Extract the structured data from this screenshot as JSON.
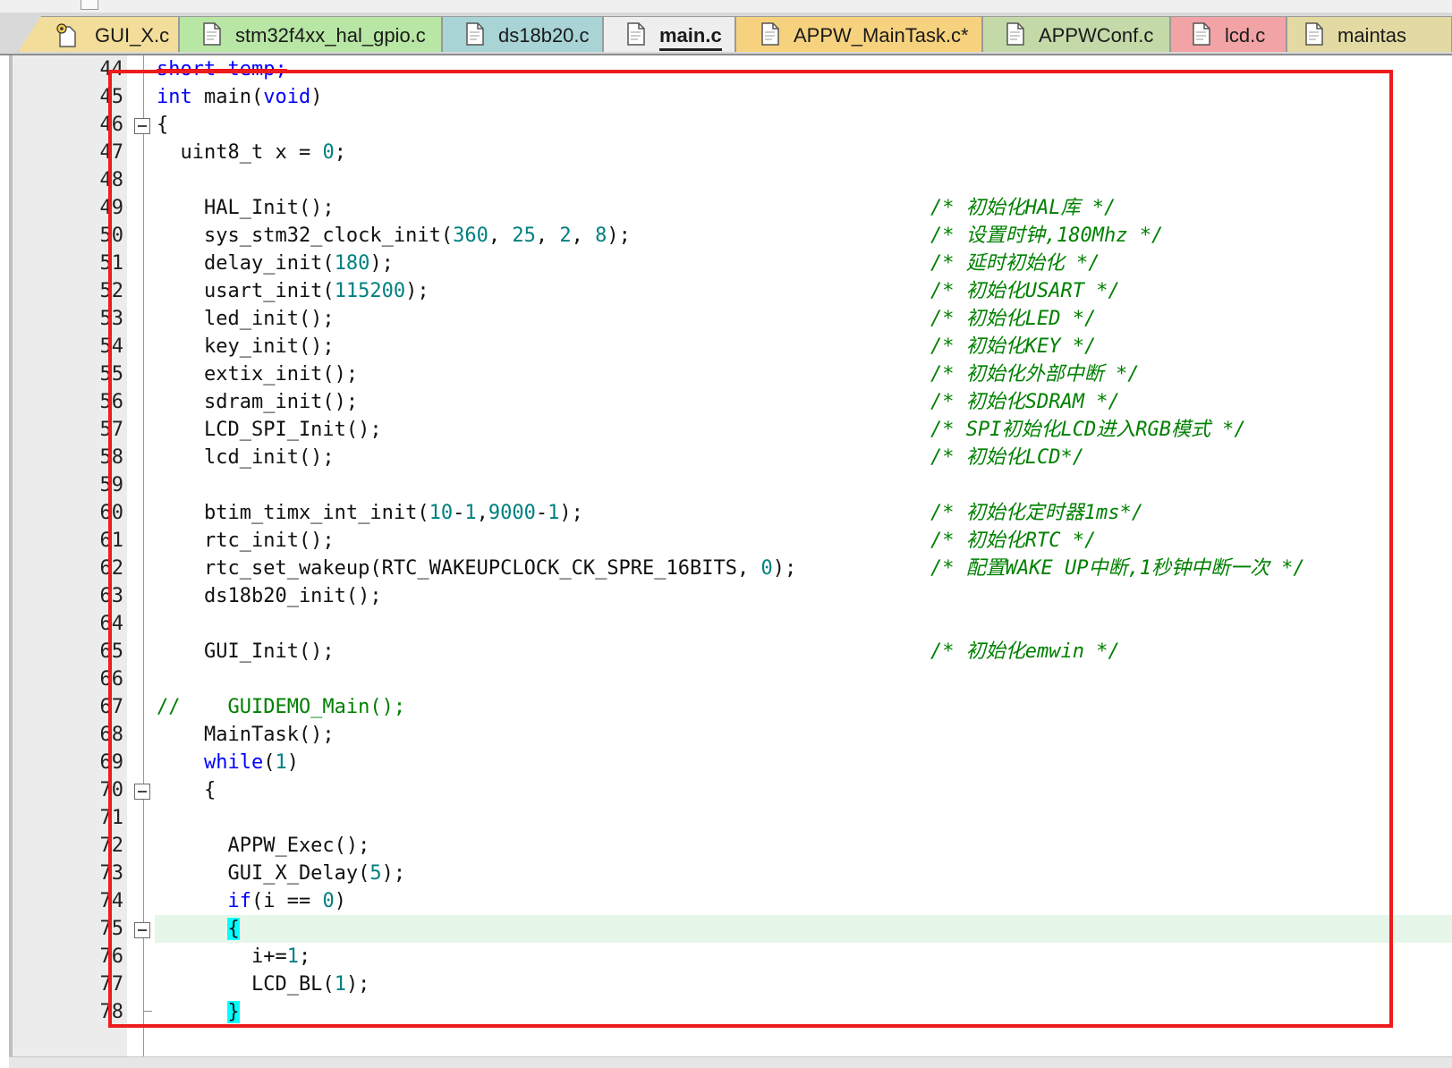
{
  "tabs": [
    {
      "label": "GUI_X.c",
      "icon": "gear-file-icon",
      "color": "#f3dd9a",
      "active": false
    },
    {
      "label": "stm32f4xx_hal_gpio.c",
      "icon": "file-icon",
      "color": "#b8e6a4",
      "active": false
    },
    {
      "label": "ds18b20.c",
      "icon": "file-icon",
      "color": "#a8d4d6",
      "active": false
    },
    {
      "label": "main.c",
      "icon": "file-icon",
      "color": "#eeeeee",
      "active": true
    },
    {
      "label": "APPW_MainTask.c*",
      "icon": "file-icon",
      "color": "#f7d27e",
      "active": false
    },
    {
      "label": "APPWConf.c",
      "icon": "file-icon",
      "color": "#c4d9a8",
      "active": false
    },
    {
      "label": "lcd.c",
      "icon": "file-icon",
      "color": "#f2a3a6",
      "active": false
    },
    {
      "label": "maintas",
      "icon": "file-icon",
      "color": "#e3d9a2",
      "active": false
    }
  ],
  "editor": {
    "current_line": 75,
    "lines": [
      {
        "n": "44",
        "code": "short temp;",
        "comment": "",
        "fold": ""
      },
      {
        "n": "45",
        "code": "int main(void)",
        "comment": "",
        "fold": ""
      },
      {
        "n": "46",
        "code": "{",
        "comment": "",
        "fold": "open"
      },
      {
        "n": "47",
        "code": "  uint8_t x = 0;",
        "comment": "",
        "fold": ""
      },
      {
        "n": "48",
        "code": "",
        "comment": "",
        "fold": ""
      },
      {
        "n": "49",
        "code": "    HAL_Init();",
        "comment": "/* 初始化HAL库 */",
        "fold": ""
      },
      {
        "n": "50",
        "code": "    sys_stm32_clock_init(360, 25, 2, 8);",
        "comment": "/* 设置时钟,180Mhz */",
        "fold": ""
      },
      {
        "n": "51",
        "code": "    delay_init(180);",
        "comment": "/* 延时初始化 */",
        "fold": ""
      },
      {
        "n": "52",
        "code": "    usart_init(115200);",
        "comment": "/* 初始化USART */",
        "fold": ""
      },
      {
        "n": "53",
        "code": "    led_init();",
        "comment": "/* 初始化LED */",
        "fold": ""
      },
      {
        "n": "54",
        "code": "    key_init();",
        "comment": "/* 初始化KEY */",
        "fold": ""
      },
      {
        "n": "55",
        "code": "    extix_init();",
        "comment": "/* 初始化外部中断 */",
        "fold": ""
      },
      {
        "n": "56",
        "code": "    sdram_init();",
        "comment": "/* 初始化SDRAM */",
        "fold": ""
      },
      {
        "n": "57",
        "code": "    LCD_SPI_Init();",
        "comment": "/* SPI初始化LCD进入RGB模式 */",
        "fold": ""
      },
      {
        "n": "58",
        "code": "    lcd_init();",
        "comment": "/* 初始化LCD*/",
        "fold": ""
      },
      {
        "n": "59",
        "code": "",
        "comment": "",
        "fold": ""
      },
      {
        "n": "60",
        "code": "    btim_timx_int_init(10-1,9000-1);",
        "comment": "/* 初始化定时器1ms*/",
        "fold": ""
      },
      {
        "n": "61",
        "code": "    rtc_init();",
        "comment": "/* 初始化RTC */",
        "fold": ""
      },
      {
        "n": "62",
        "code": "    rtc_set_wakeup(RTC_WAKEUPCLOCK_CK_SPRE_16BITS, 0);",
        "comment": "/* 配置WAKE UP中断,1秒钟中断一次 */",
        "fold": ""
      },
      {
        "n": "63",
        "code": "    ds18b20_init();",
        "comment": "",
        "fold": ""
      },
      {
        "n": "64",
        "code": "",
        "comment": "",
        "fold": ""
      },
      {
        "n": "65",
        "code": "    GUI_Init();",
        "comment": "/* 初始化emwin */",
        "fold": ""
      },
      {
        "n": "66",
        "code": "",
        "comment": "",
        "fold": ""
      },
      {
        "n": "67",
        "code": "//    GUIDEMO_Main();",
        "comment": "",
        "fold": ""
      },
      {
        "n": "68",
        "code": "    MainTask();",
        "comment": "",
        "fold": ""
      },
      {
        "n": "69",
        "code": "    while(1)",
        "comment": "",
        "fold": ""
      },
      {
        "n": "70",
        "code": "    {",
        "comment": "",
        "fold": "open"
      },
      {
        "n": "71",
        "code": "",
        "comment": "",
        "fold": ""
      },
      {
        "n": "72",
        "code": "      APPW_Exec();",
        "comment": "",
        "fold": ""
      },
      {
        "n": "73",
        "code": "      GUI_X_Delay(5);",
        "comment": "",
        "fold": ""
      },
      {
        "n": "74",
        "code": "      if(i == 0)",
        "comment": "",
        "fold": ""
      },
      {
        "n": "75",
        "code": "      {",
        "comment": "",
        "fold": "open"
      },
      {
        "n": "76",
        "code": "        i+=1;",
        "comment": "",
        "fold": ""
      },
      {
        "n": "77",
        "code": "        LCD_BL(1);",
        "comment": "",
        "fold": ""
      },
      {
        "n": "78",
        "code": "      }",
        "comment": "",
        "fold": "end"
      }
    ]
  }
}
